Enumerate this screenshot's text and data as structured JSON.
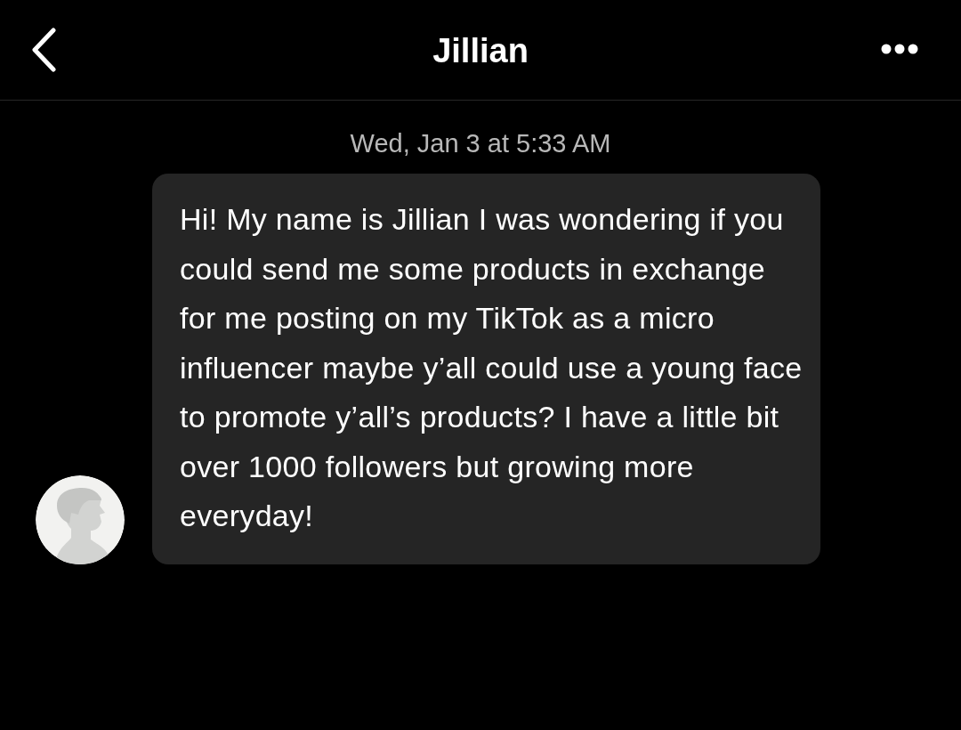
{
  "header": {
    "title": "Jillian"
  },
  "messages": [
    {
      "timestamp": "Wed, Jan 3 at 5:33 AM",
      "text": "Hi! My name is Jillian I was wondering if you could send me some products in exchange for me posting on my TikTok as a micro influencer maybe y’all could use a young face to promote y’all’s products? I have a little bit over 1000 followers but growing more everyday!"
    }
  ]
}
